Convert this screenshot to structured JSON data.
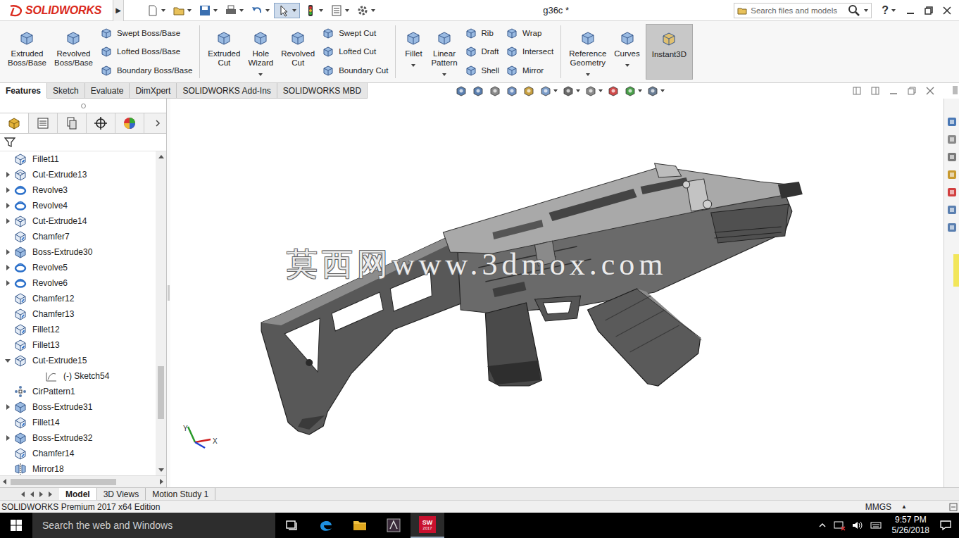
{
  "window": {
    "title": "g36c *"
  },
  "app": {
    "logo": "SOLIDWORKS"
  },
  "quick_access": {
    "expand": "▶",
    "tools": [
      {
        "selected": false
      },
      {
        "selected": false
      },
      {
        "selected": false
      },
      {
        "selected": false
      },
      {
        "selected": false
      },
      {
        "selected": true
      },
      {
        "selected": false
      },
      {
        "selected": false
      },
      {
        "selected": false
      }
    ]
  },
  "search": {
    "placeholder": "Search files and models"
  },
  "help": "?",
  "ribbon": [
    {
      "kind": "large",
      "label": "Extruded Boss/Base",
      "dropdown": false,
      "selected": false
    },
    {
      "kind": "large",
      "label": "Revolved Boss/Base",
      "dropdown": false,
      "selected": false
    },
    {
      "kind": "stack",
      "items": [
        "Swept Boss/Base",
        "Lofted Boss/Base",
        "Boundary Boss/Base"
      ]
    },
    {
      "kind": "separator"
    },
    {
      "kind": "large",
      "label": "Extruded Cut",
      "dropdown": false,
      "selected": false
    },
    {
      "kind": "large",
      "label": "Hole Wizard",
      "dropdown": true,
      "selected": false
    },
    {
      "kind": "large",
      "label": "Revolved Cut",
      "dropdown": false,
      "selected": false
    },
    {
      "kind": "stack",
      "items": [
        "Swept Cut",
        "Lofted Cut",
        "Boundary Cut"
      ]
    },
    {
      "kind": "separator"
    },
    {
      "kind": "large",
      "label": "Fillet",
      "dropdown": true,
      "selected": false
    },
    {
      "kind": "large",
      "label": "Linear Pattern",
      "dropdown": true,
      "selected": false
    },
    {
      "kind": "stack",
      "items": [
        "Rib",
        "Draft",
        "Shell"
      ]
    },
    {
      "kind": "stack",
      "items": [
        "Wrap",
        "Intersect",
        "Mirror"
      ]
    },
    {
      "kind": "separator"
    },
    {
      "kind": "large",
      "label": "Reference Geometry",
      "dropdown": true,
      "selected": false
    },
    {
      "kind": "large",
      "label": "Curves",
      "dropdown": true,
      "selected": false
    },
    {
      "kind": "large",
      "label": "Instant3D",
      "dropdown": false,
      "selected": true
    }
  ],
  "command_tabs": [
    {
      "label": "Features",
      "selected": true
    },
    {
      "label": "Sketch",
      "selected": false
    },
    {
      "label": "Evaluate",
      "selected": false
    },
    {
      "label": "DimXpert",
      "selected": false
    },
    {
      "label": "SOLIDWORKS Add-Ins",
      "selected": false
    },
    {
      "label": "SOLIDWORKS MBD",
      "selected": false
    }
  ],
  "panel_tabs": [
    {
      "selected": true
    },
    {
      "selected": false
    },
    {
      "selected": false
    },
    {
      "selected": false
    },
    {
      "selected": false
    }
  ],
  "tree": [
    {
      "label": "Fillet11",
      "kind": "fillet",
      "expandable": false,
      "expanded": false,
      "child": false
    },
    {
      "label": "Cut-Extrude13",
      "kind": "cut",
      "expandable": true,
      "expanded": false,
      "child": false
    },
    {
      "label": "Revolve3",
      "kind": "revolve",
      "expandable": true,
      "expanded": false,
      "child": false
    },
    {
      "label": "Revolve4",
      "kind": "revolve",
      "expandable": true,
      "expanded": false,
      "child": false
    },
    {
      "label": "Cut-Extrude14",
      "kind": "cut",
      "expandable": true,
      "expanded": false,
      "child": false
    },
    {
      "label": "Chamfer7",
      "kind": "chamfer",
      "expandable": false,
      "expanded": false,
      "child": false
    },
    {
      "label": "Boss-Extrude30",
      "kind": "boss",
      "expandable": true,
      "expanded": false,
      "child": false
    },
    {
      "label": "Revolve5",
      "kind": "revolve",
      "expandable": true,
      "expanded": false,
      "child": false
    },
    {
      "label": "Revolve6",
      "kind": "revolve",
      "expandable": true,
      "expanded": false,
      "child": false
    },
    {
      "label": "Chamfer12",
      "kind": "chamfer",
      "expandable": false,
      "expanded": false,
      "child": false
    },
    {
      "label": "Chamfer13",
      "kind": "chamfer",
      "expandable": false,
      "expanded": false,
      "child": false
    },
    {
      "label": "Fillet12",
      "kind": "fillet",
      "expandable": false,
      "expanded": false,
      "child": false
    },
    {
      "label": "Fillet13",
      "kind": "fillet",
      "expandable": false,
      "expanded": false,
      "child": false
    },
    {
      "label": "Cut-Extrude15",
      "kind": "cut",
      "expandable": true,
      "expanded": true,
      "child": false
    },
    {
      "label": "(-) Sketch54",
      "kind": "sketch",
      "expandable": false,
      "expanded": false,
      "child": true
    },
    {
      "label": "CirPattern1",
      "kind": "pattern",
      "expandable": false,
      "expanded": false,
      "child": false
    },
    {
      "label": "Boss-Extrude31",
      "kind": "boss",
      "expandable": true,
      "expanded": false,
      "child": false
    },
    {
      "label": "Fillet14",
      "kind": "fillet",
      "expandable": false,
      "expanded": false,
      "child": false
    },
    {
      "label": "Boss-Extrude32",
      "kind": "boss",
      "expandable": true,
      "expanded": false,
      "child": false
    },
    {
      "label": "Chamfer14",
      "kind": "chamfer",
      "expandable": false,
      "expanded": false,
      "child": false
    },
    {
      "label": "Mirror18",
      "kind": "mirror",
      "expandable": false,
      "expanded": false,
      "child": false
    }
  ],
  "viewport": {
    "watermark": "莫西网www.3dmox.com",
    "triad": {
      "x": "X",
      "y": "Y"
    }
  },
  "model_tabs": [
    {
      "label": "Model",
      "selected": true
    },
    {
      "label": "3D Views",
      "selected": false
    },
    {
      "label": "Motion Study 1",
      "selected": false
    }
  ],
  "status_bar": {
    "edition": "SOLIDWORKS Premium 2017 x64 Edition",
    "units": "MMGS",
    "units_arrow": "▲"
  },
  "taskbar": {
    "search": "Search the web and Windows",
    "solidworks_badge": {
      "top": "SW",
      "bottom": "2017"
    },
    "time": "9:57 PM",
    "date": "5/26/2018"
  }
}
